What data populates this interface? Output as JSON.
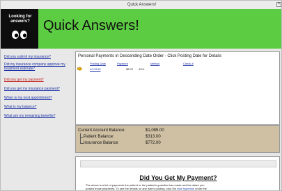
{
  "window": {
    "title": "Quick Answers!",
    "close_glyph": "×"
  },
  "header": {
    "logo_text_1": "Looking for",
    "logo_text_2": "answers?",
    "logo_icon": "eyes-icon",
    "title": "Quick Answers!",
    "accent_color": "#5ccc42"
  },
  "sidebar": {
    "items": [
      {
        "label": "Did you submit my insurance?"
      },
      {
        "label": "Did my insurance company approve my treatment estimate?"
      },
      {
        "label": "Did you get my payment?"
      },
      {
        "label": "Did you get my insurance payment?"
      },
      {
        "label": "When is my next appointment?"
      },
      {
        "label": "What is my balance?"
      },
      {
        "label": "What are my remaining benefits?"
      }
    ]
  },
  "payments": {
    "title": "Personal Payments in Descending Date Order - Click Posting Date for Details",
    "columns": [
      "Posting Date",
      "Payment",
      "Method",
      "Check #"
    ],
    "rows": [
      {
        "date": "4/1/2016",
        "payment": "$8.00",
        "method": "ACH",
        "check": ""
      }
    ]
  },
  "balances": {
    "current_label": "Current Account Balance:",
    "current_value": "$1,085.00",
    "patient_label": "Patient Balance:",
    "patient_value": "$313.00",
    "insurance_label": "Insurance Balance",
    "insurance_value": "$772.00"
  },
  "help": {
    "heading": "Did You Get My Payment?",
    "text_1": "The above is a list of payments the patient or the patient's guardian has made and the dates you",
    "text_2a": "posted those payments.  To see the details on any date's posting, click the",
    "text_2b": "blue hyperlink",
    "text_2c": "under the"
  }
}
